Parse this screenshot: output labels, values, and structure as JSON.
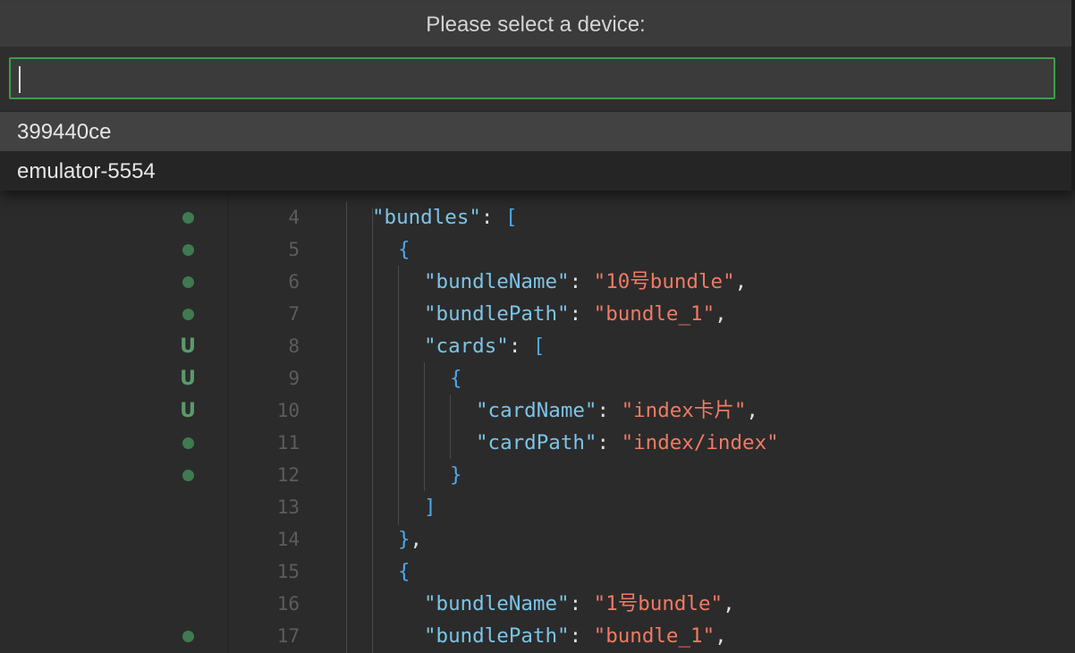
{
  "quick_pick": {
    "title": "Please select a device:",
    "input_value": "",
    "items": [
      {
        "label": "399440ce",
        "selected": true
      },
      {
        "label": "emulator-5554",
        "selected": false
      }
    ]
  },
  "editor": {
    "colors": {
      "key": "#7cc4e8",
      "string": "#f07a63",
      "bracket": "#4fa8e8",
      "punct": "#e0e0e0",
      "marker_green": "#3f7a50"
    },
    "lines": [
      {
        "number": "4",
        "marker": "dot",
        "tokens": [
          {
            "t": "k",
            "v": "\"bundles\""
          },
          {
            "t": "p",
            "v": ": "
          },
          {
            "t": "b",
            "v": "["
          }
        ]
      },
      {
        "number": "5",
        "marker": "dot",
        "tokens": [
          {
            "t": "b",
            "v": "{"
          }
        ]
      },
      {
        "number": "6",
        "marker": "dot",
        "tokens": [
          {
            "t": "k",
            "v": "\"bundleName\""
          },
          {
            "t": "p",
            "v": ": "
          },
          {
            "t": "s",
            "v": "\"10号bundle\""
          },
          {
            "t": "p",
            "v": ","
          }
        ]
      },
      {
        "number": "7",
        "marker": "dot",
        "tokens": [
          {
            "t": "k",
            "v": "\"bundlePath\""
          },
          {
            "t": "p",
            "v": ": "
          },
          {
            "t": "s",
            "v": "\"bundle_1\""
          },
          {
            "t": "p",
            "v": ","
          }
        ]
      },
      {
        "number": "8",
        "marker": "U",
        "tokens": [
          {
            "t": "k",
            "v": "\"cards\""
          },
          {
            "t": "p",
            "v": ": "
          },
          {
            "t": "b",
            "v": "["
          }
        ]
      },
      {
        "number": "9",
        "marker": "U",
        "tokens": [
          {
            "t": "b",
            "v": "{"
          }
        ]
      },
      {
        "number": "10",
        "marker": "U",
        "tokens": [
          {
            "t": "k",
            "v": "\"cardName\""
          },
          {
            "t": "p",
            "v": ": "
          },
          {
            "t": "s",
            "v": "\"index卡片\""
          },
          {
            "t": "p",
            "v": ","
          }
        ]
      },
      {
        "number": "11",
        "marker": "dot",
        "tokens": [
          {
            "t": "k",
            "v": "\"cardPath\""
          },
          {
            "t": "p",
            "v": ": "
          },
          {
            "t": "s",
            "v": "\"index/index\""
          }
        ]
      },
      {
        "number": "12",
        "marker": "dot",
        "tokens": [
          {
            "t": "b",
            "v": "}"
          }
        ]
      },
      {
        "number": "13",
        "marker": "",
        "tokens": [
          {
            "t": "b",
            "v": "]"
          }
        ]
      },
      {
        "number": "14",
        "marker": "",
        "tokens": [
          {
            "t": "b",
            "v": "}"
          },
          {
            "t": "p",
            "v": ","
          }
        ]
      },
      {
        "number": "15",
        "marker": "",
        "tokens": [
          {
            "t": "b",
            "v": "{"
          }
        ]
      },
      {
        "number": "16",
        "marker": "",
        "tokens": [
          {
            "t": "k",
            "v": "\"bundleName\""
          },
          {
            "t": "p",
            "v": ": "
          },
          {
            "t": "s",
            "v": "\"1号bundle\""
          },
          {
            "t": "p",
            "v": ","
          }
        ]
      },
      {
        "number": "17",
        "marker": "dot",
        "tokens": [
          {
            "t": "k",
            "v": "\"bundlePath\""
          },
          {
            "t": "p",
            "v": ": "
          },
          {
            "t": "s",
            "v": "\"bundle_1\""
          },
          {
            "t": "p",
            "v": ","
          }
        ]
      }
    ]
  }
}
